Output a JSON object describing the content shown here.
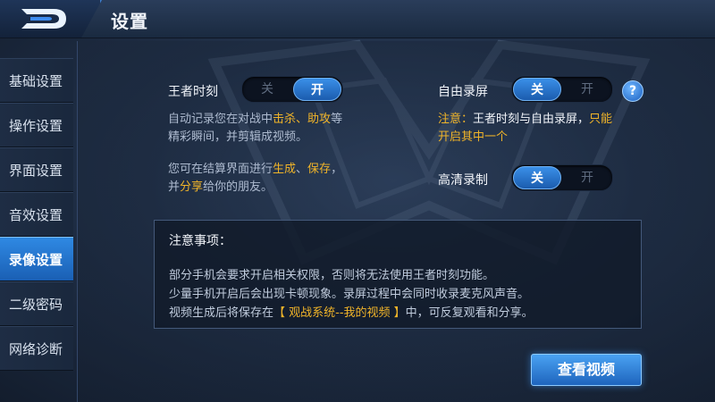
{
  "header": {
    "title": "设置"
  },
  "sidebar": {
    "items": [
      {
        "label": "基础设置",
        "active": false
      },
      {
        "label": "操作设置",
        "active": false
      },
      {
        "label": "界面设置",
        "active": false
      },
      {
        "label": "音效设置",
        "active": false
      },
      {
        "label": "录像设置",
        "active": true
      },
      {
        "label": "二级密码",
        "active": false
      },
      {
        "label": "网络诊断",
        "active": false
      }
    ]
  },
  "settings": {
    "kings_moment": {
      "label": "王者时刻",
      "off_label": "关",
      "on_label": "开",
      "state": "on",
      "desc_line1_a": "自动记录您在对战中",
      "desc_line1_hl1": "击杀",
      "desc_line1_sep": "、",
      "desc_line1_hl2": "助攻",
      "desc_line1_b": "等",
      "desc_line2": "精彩瞬间，并剪辑成视频。",
      "desc_line3_a": "您可在结算界面进行",
      "desc_line3_hl1": "生成",
      "desc_line3_sep": "、",
      "desc_line3_hl2": "保存",
      "desc_line3_b": "，",
      "desc_line4_a": "并",
      "desc_line4_hl": "分享",
      "desc_line4_b": "给你的朋友。"
    },
    "free_record": {
      "label": "自由录屏",
      "off_label": "关",
      "on_label": "开",
      "state": "off",
      "warn_prefix": "注意：",
      "warn_text": "王者时刻与自由录屏，",
      "warn_hl": "只能",
      "warn_line2": "开启其中一个",
      "help": "?"
    },
    "hd_record": {
      "label": "高清录制",
      "off_label": "关",
      "on_label": "开",
      "state": "off"
    }
  },
  "notes": {
    "title": "注意事项：",
    "line1": "部分手机会要求开启相关权限，否则将无法使用王者时刻功能。",
    "line2": "少量手机开启后会出现卡顿现象。录屏过程中会同时收录麦克风声音。",
    "line3_a": "视频生成后将保存在",
    "line3_hl": "【 观战系统--我的视频 】",
    "line3_b": "中，可反复观看和分享。"
  },
  "actions": {
    "view_videos": "查看视频"
  },
  "colors": {
    "accent_blue": "#2f89e3",
    "highlight_orange": "#f0b429",
    "background": "#22324b"
  }
}
